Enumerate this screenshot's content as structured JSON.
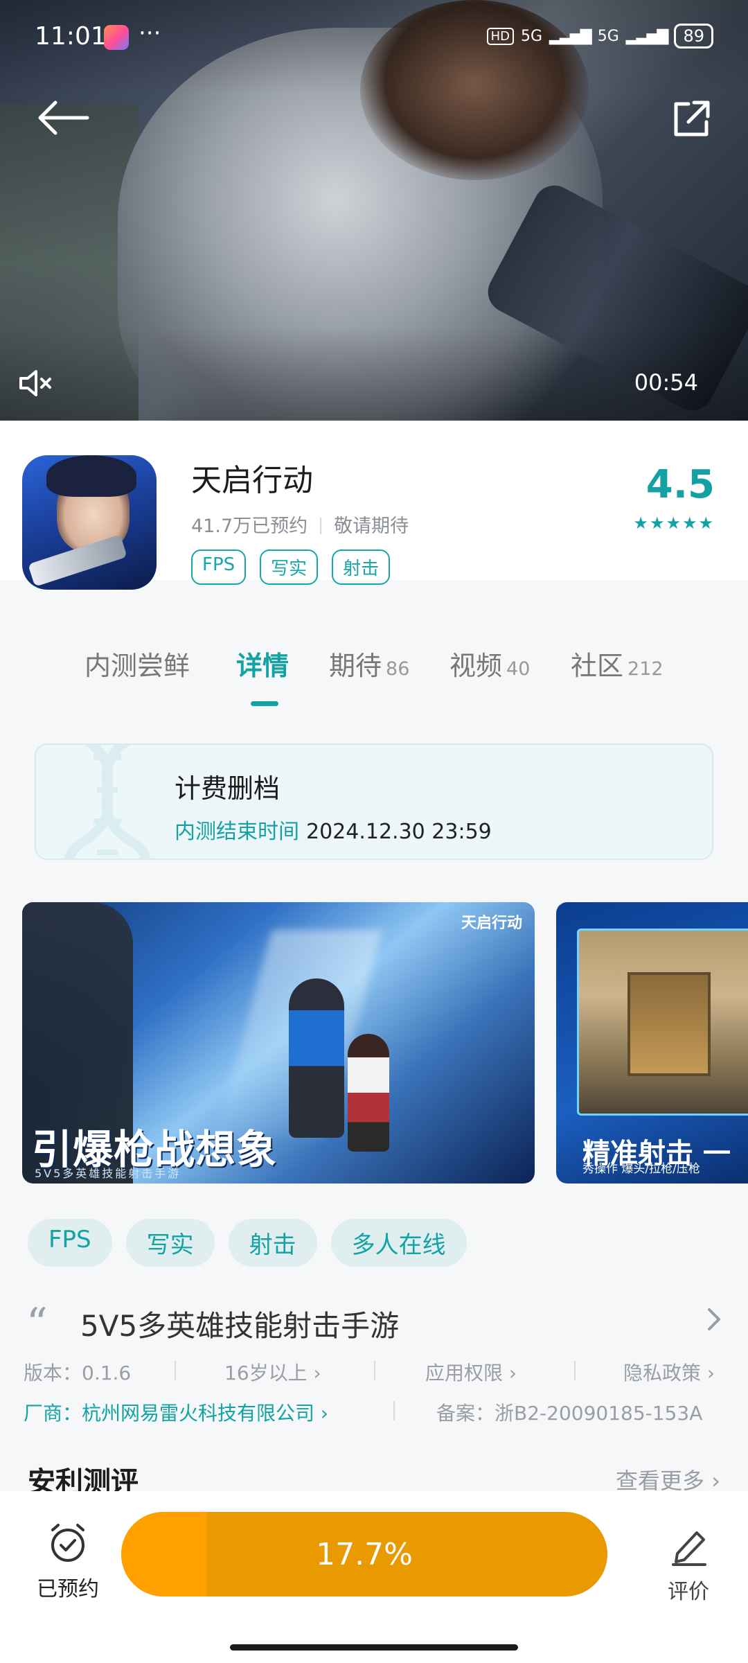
{
  "status_bar": {
    "time": "11:01",
    "more": "···",
    "hd": "HD",
    "net1": "5G",
    "net2": "5G",
    "battery": "89"
  },
  "video": {
    "duration": "00:54"
  },
  "app": {
    "name": "天启行动",
    "reservations": "41.7万已预约",
    "status": "敬请期待",
    "tags": [
      "FPS",
      "写实",
      "射击"
    ],
    "rating": "4.5",
    "stars": "★★★★★"
  },
  "tabs": [
    {
      "label": "内测尝鲜",
      "count": ""
    },
    {
      "label": "详情",
      "count": ""
    },
    {
      "label": "期待",
      "count": "86"
    },
    {
      "label": "视频",
      "count": "40"
    },
    {
      "label": "社区",
      "count": "212"
    }
  ],
  "notice": {
    "title": "计费删档",
    "end_label": "内测结束时间",
    "end_date": "2024.12.30 23:59"
  },
  "screenshots": [
    {
      "logo": "天启行动",
      "caption": "引爆枪战想象",
      "subcaption": "5V5多英雄技能射击手游"
    },
    {
      "caption": "精准射击 一",
      "subcaption": "秀操作  爆头/拉枪/压枪"
    }
  ],
  "chips": [
    "FPS",
    "写实",
    "射击",
    "多人在线"
  ],
  "description": {
    "quote": "“",
    "text": "5V5多英雄技能射击手游"
  },
  "info": {
    "version": "版本：0.1.6",
    "age": "16岁以上 ›",
    "permissions": "应用权限 ›",
    "privacy": "隐私政策 ›",
    "vendor": "厂商：杭州网易雷火科技有限公司 ›",
    "record": "备案：浙B2-20090185-153A"
  },
  "section": {
    "title": "安利测评",
    "see_more": "查看更多 ›"
  },
  "bottom": {
    "reserved_label": "已预约",
    "progress_text": "17.7%",
    "progress": 0.177,
    "review_label": "评价"
  },
  "colors": {
    "accent": "#14a3a4",
    "progress_fill": "#ff9f00",
    "progress_track": "#e89a00"
  }
}
